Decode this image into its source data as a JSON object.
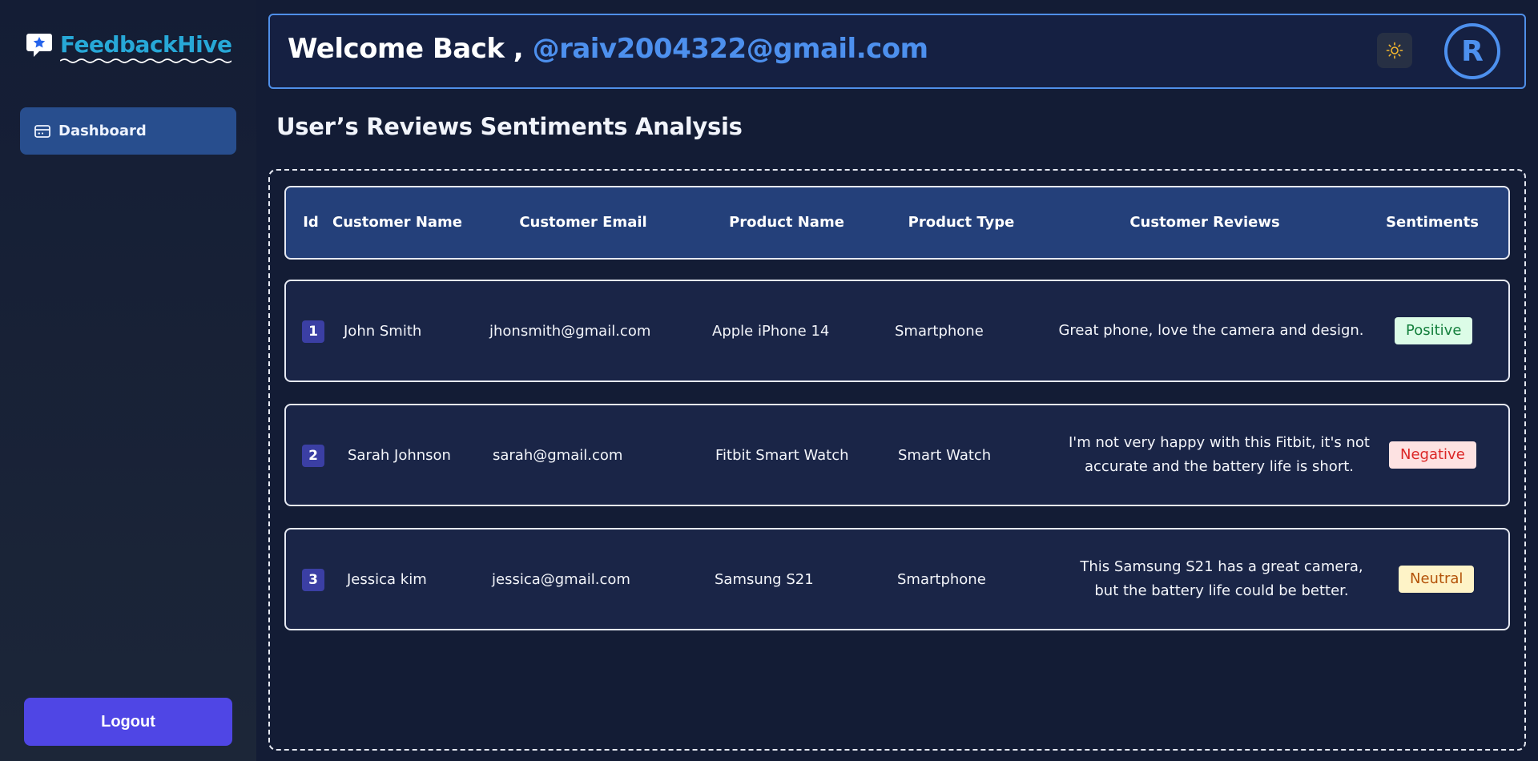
{
  "brand": {
    "name": "FeedbackHive",
    "icon": "chat-star-icon"
  },
  "sidebar": {
    "items": [
      {
        "label": "Dashboard",
        "icon": "card-icon"
      }
    ],
    "logout_label": "Logout"
  },
  "header": {
    "welcome": "Welcome Back ,",
    "email": "@raiv2004322@gmail.com",
    "theme_icon": "sun-icon",
    "avatar_initial": "R"
  },
  "page": {
    "title": "User’s Reviews Sentiments Analysis"
  },
  "table": {
    "columns": [
      "Id",
      "Customer Name",
      "Customer Email",
      "Product Name",
      "Product Type",
      "Customer Reviews",
      "Sentiments"
    ],
    "rows": [
      {
        "id": "1",
        "name": "John Smith",
        "email": "jhonsmith@gmail.com",
        "product": "Apple iPhone 14",
        "type": "Smartphone",
        "review": "Great phone, love the camera and design.",
        "sentiment": "Positive"
      },
      {
        "id": "2",
        "name": "Sarah Johnson",
        "email": "sarah@gmail.com",
        "product": "Fitbit Smart Watch",
        "type": "Smart Watch",
        "review": "I'm not very happy with this Fitbit, it's not accurate and the battery life is short.",
        "sentiment": "Negative"
      },
      {
        "id": "3",
        "name": "Jessica kim",
        "email": "jessica@gmail.com",
        "product": "Samsung S21",
        "type": "Smartphone",
        "review": "This Samsung S21 has a great camera, but the battery life could be better.",
        "sentiment": "Neutral"
      }
    ]
  },
  "colors": {
    "background": "#131c35",
    "accent": "#4d90ee",
    "brand": "#27a8d7",
    "logout": "#4f46e5",
    "positive": "#15803d",
    "negative": "#dc2626",
    "neutral": "#b45309"
  }
}
